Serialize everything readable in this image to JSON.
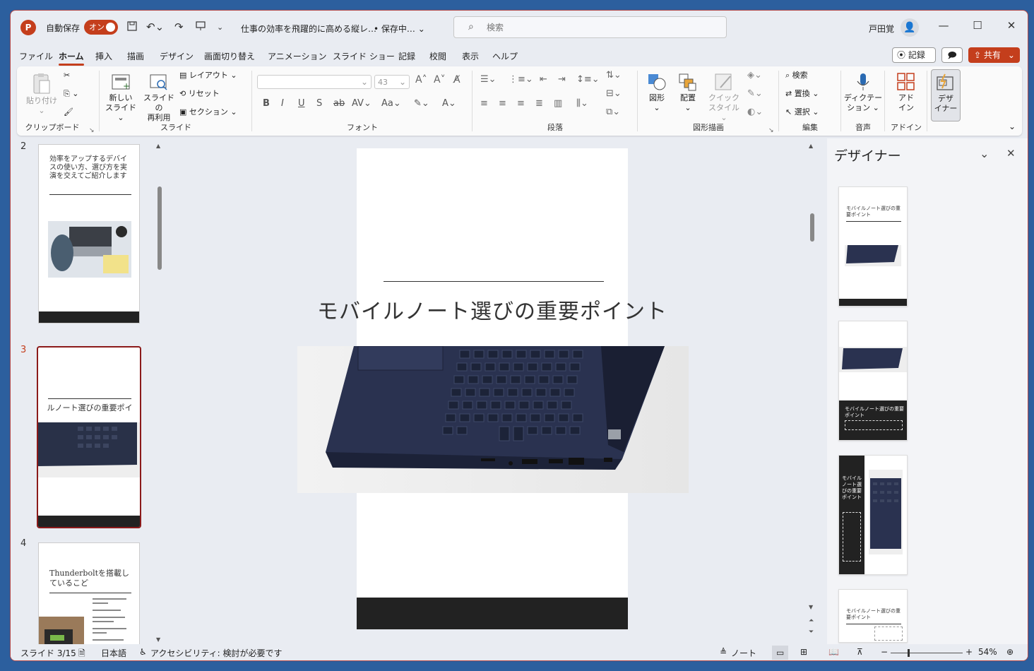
{
  "titlebar": {
    "app_icon": "P",
    "autosave_label": "自動保存",
    "autosave_toggle": "オン",
    "doc_title": "仕事の効率を飛躍的に高める縦レ…",
    "doc_status": "• 保存中… ⌄",
    "search_placeholder": "検索",
    "user_name": "戸田覚"
  },
  "menu": {
    "tabs": [
      "ファイル",
      "ホーム",
      "挿入",
      "描画",
      "デザイン",
      "画面切り替え",
      "アニメーション",
      "スライド ショー",
      "記録",
      "校閲",
      "表示",
      "ヘルプ"
    ],
    "record_button": "記録",
    "share_button": "共有"
  },
  "ribbon": {
    "clipboard": {
      "paste": "貼り付け",
      "group": "クリップボード"
    },
    "slides": {
      "new_slide_1": "新しい",
      "new_slide_2": "スライド",
      "reuse_1": "スライドの",
      "reuse_2": "再利用",
      "layout": "レイアウト",
      "reset": "リセット",
      "section": "セクション",
      "group": "スライド"
    },
    "font": {
      "font_size": "43",
      "group": "フォント"
    },
    "paragraph": {
      "group": "段落"
    },
    "drawing": {
      "shapes": "図形",
      "arrange": "配置",
      "quick_1": "クイック",
      "quick_2": "スタイル",
      "group": "図形描画"
    },
    "editing": {
      "find": "検索",
      "replace": "置換",
      "select": "選択",
      "group": "編集"
    },
    "voice": {
      "dictate_1": "ディクテー",
      "dictate_2": "ション",
      "group": "音声"
    },
    "addins": {
      "label_1": "アド",
      "label_2": "イン",
      "group": "アドイン"
    },
    "designer": {
      "label_1": "デザ",
      "label_2": "イナー"
    }
  },
  "thumbnails": [
    {
      "number": "2",
      "title": "効率をアップするデバイスの使い方、選び方を実演を交えてご紹介します"
    },
    {
      "number": "3",
      "title": "ルノート選びの重要ポイ"
    },
    {
      "number": "4",
      "title": "Thunderboltを搭載しているこど"
    }
  ],
  "slide": {
    "title": "モバイルノート選びの重要ポイント"
  },
  "designer": {
    "title": "デザイナー",
    "option1_title": "モバイルノート選びの重要ポイント",
    "option2_title": "モバイルノート選びの重要ポイント",
    "option3_title": "モバイルノート選びの重要ポイント",
    "option4_title": "モバイルノート選びの重要ポイント"
  },
  "status": {
    "slide_position": "スライド 3/15",
    "language": "日本語",
    "accessibility": "アクセシビリティ: 検討が必要です",
    "notes": "ノート",
    "zoom": "54%"
  },
  "colors": {
    "accent": "#c43e1c",
    "selection": "#8b1a1a"
  }
}
